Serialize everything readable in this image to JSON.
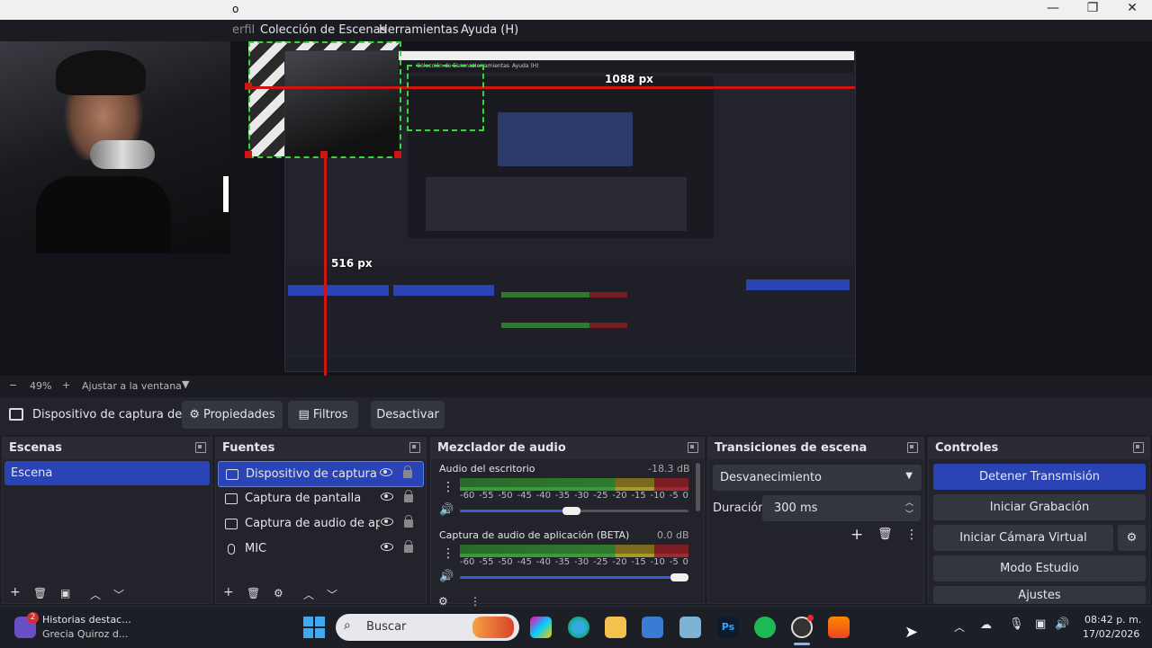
{
  "window": {
    "title": "o",
    "controls": [
      "minimize",
      "maximize",
      "close"
    ]
  },
  "menubar": {
    "items": [
      "erfil",
      "Colección de Escenas",
      "Herramientas",
      "Ayuda (H)"
    ]
  },
  "preview": {
    "width_label": "1088 px",
    "height_label": "516 px",
    "nested_menu": [
      "Colección de Escenas",
      "Herramientas",
      "Ayuda (H)"
    ]
  },
  "zoom": {
    "minus": "−",
    "value": "49%",
    "plus": "+",
    "fit": "Ajustar a la ventana"
  },
  "source_toolbar": {
    "source_name": "Dispositivo de captura de v",
    "properties": "Propiedades",
    "filters": "Filtros",
    "deactivate": "Desactivar"
  },
  "scenes": {
    "title": "Escenas",
    "items": [
      "Escena"
    ]
  },
  "sources": {
    "title": "Fuentes",
    "items": [
      {
        "label": "Dispositivo de captura de v",
        "icon": "camera-icon"
      },
      {
        "label": "Captura de pantalla",
        "icon": "monitor-icon"
      },
      {
        "label": "Captura de audio de aplica",
        "icon": "app-audio-icon"
      },
      {
        "label": "MIC",
        "icon": "microphone-icon"
      }
    ]
  },
  "mixer": {
    "title": "Mezclador de audio",
    "channels": [
      {
        "name": "Audio del escritorio",
        "db": "-18.3 dB",
        "volume": 0.49
      },
      {
        "name": "Captura de audio de aplicación (BETA)",
        "db": "0.0 dB",
        "volume": 0.96
      }
    ],
    "ticks": [
      "-60",
      "-55",
      "-50",
      "-45",
      "-40",
      "-35",
      "-30",
      "-25",
      "-20",
      "-15",
      "-10",
      "-5",
      "0"
    ]
  },
  "transitions": {
    "title": "Transiciones de escena",
    "selected": "Desvanecimiento",
    "duration_label": "Duración",
    "duration_value": "300 ms"
  },
  "controls": {
    "title": "Controles",
    "buttons": [
      "Detener Transmisión",
      "Iniciar Grabación",
      "Iniciar Cámara Virtual",
      "Modo Estudio",
      "Ajustes"
    ]
  },
  "taskbar": {
    "notification": {
      "badge": "2",
      "title": "Historias destac...",
      "subtitle": "Grecia Quiroz d..."
    },
    "search_placeholder": "Buscar",
    "clock": {
      "time": "08:42 p. m.",
      "date": "17/02/2026"
    }
  },
  "colors": {
    "accent": "#2a44b5",
    "panel": "#22232b",
    "background": "#1e1f26",
    "guide_red": "#d01414",
    "guide_green": "#35d835"
  }
}
